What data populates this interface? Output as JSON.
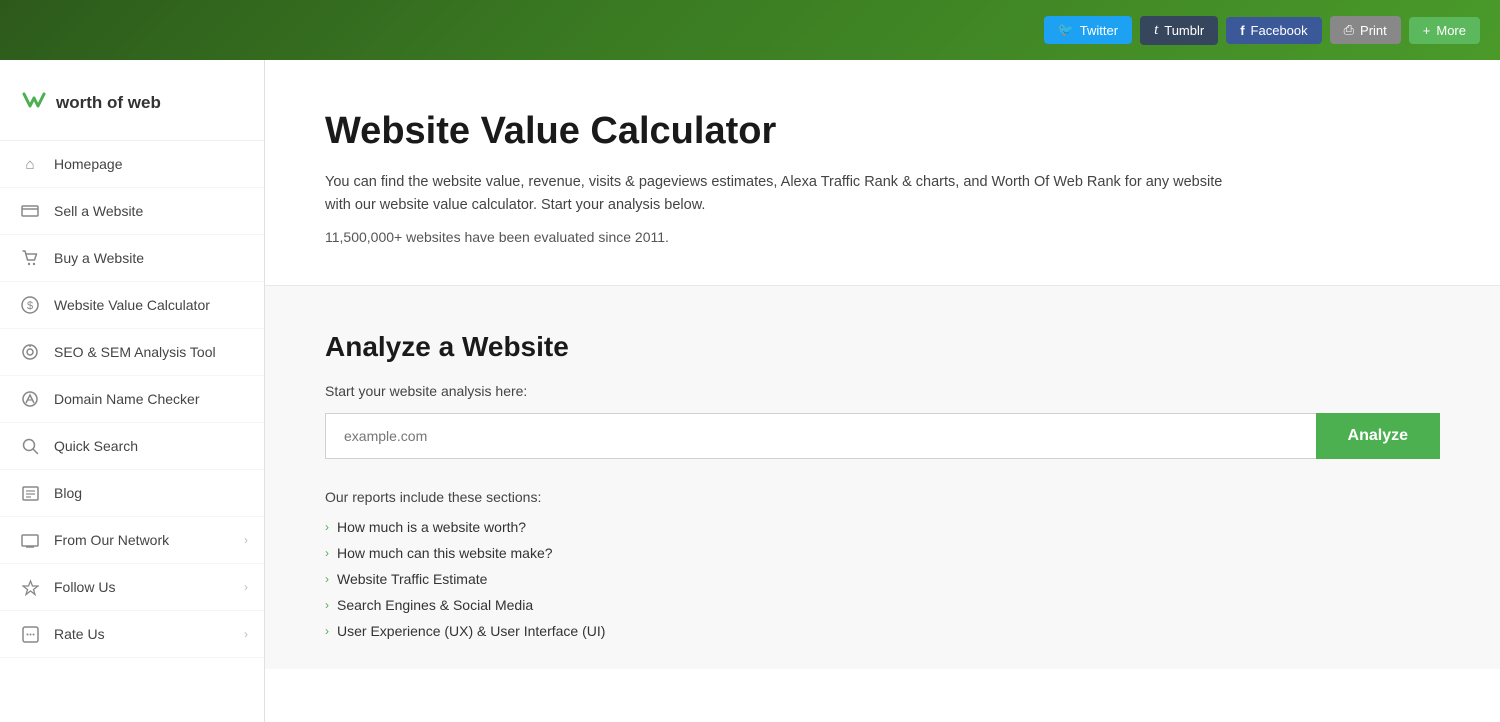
{
  "topbar": {
    "buttons": [
      {
        "id": "twitter",
        "label": "Twitter",
        "class": "twitter",
        "icon": "🐦"
      },
      {
        "id": "tumblr",
        "label": "Tumblr",
        "class": "tumblr",
        "icon": "t"
      },
      {
        "id": "facebook",
        "label": "Facebook",
        "class": "facebook",
        "icon": "f"
      },
      {
        "id": "print",
        "label": "Print",
        "class": "print",
        "icon": "🖨"
      },
      {
        "id": "more",
        "label": "More",
        "class": "more",
        "icon": "+"
      }
    ]
  },
  "logo": {
    "icon": "W",
    "text": "worth of web"
  },
  "nav": {
    "items": [
      {
        "id": "homepage",
        "label": "Homepage",
        "icon": "⌂",
        "arrow": false
      },
      {
        "id": "sell-website",
        "label": "Sell a Website",
        "icon": "💳",
        "arrow": false
      },
      {
        "id": "buy-website",
        "label": "Buy a Website",
        "icon": "🛍",
        "arrow": false
      },
      {
        "id": "website-value-calculator",
        "label": "Website Value Calculator",
        "icon": "💲",
        "arrow": false
      },
      {
        "id": "seo-sem-analysis",
        "label": "SEO & SEM Analysis Tool",
        "icon": "◎",
        "arrow": false
      },
      {
        "id": "domain-name-checker",
        "label": "Domain Name Checker",
        "icon": "✓",
        "arrow": false
      },
      {
        "id": "quick-search",
        "label": "Quick Search",
        "icon": "🔍",
        "arrow": false
      },
      {
        "id": "blog",
        "label": "Blog",
        "icon": "☰",
        "arrow": false
      },
      {
        "id": "from-our-network",
        "label": "From Our Network",
        "icon": "🖥",
        "arrow": true
      },
      {
        "id": "follow-us",
        "label": "Follow Us",
        "icon": "🔔",
        "arrow": true
      },
      {
        "id": "rate-us",
        "label": "Rate Us",
        "icon": "💬",
        "arrow": true
      }
    ]
  },
  "hero": {
    "title": "Website Value Calculator",
    "description": "You can find the website value, revenue, visits & pageviews estimates, Alexa Traffic Rank & charts, and Worth Of Web Rank for any website with our website value calculator. Start your analysis below.",
    "count_text": "11,500,000+ websites have been evaluated since 2011."
  },
  "analyze": {
    "title": "Analyze a Website",
    "sublabel": "Start your website analysis here:",
    "input_placeholder": "example.com",
    "button_label": "Analyze",
    "reports_intro": "Our reports include these sections:",
    "report_items": [
      "How much is a website worth?",
      "How much can this website make?",
      "Website Traffic Estimate",
      "Search Engines & Social Media",
      "User Experience (UX) & User Interface (UI)"
    ]
  }
}
